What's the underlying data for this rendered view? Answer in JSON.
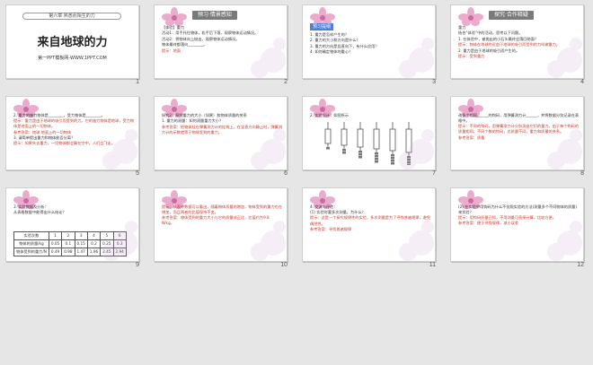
{
  "accent": "#4f7ed6",
  "slides": [
    {
      "num": "1",
      "chapter": "第六章 熟悉而陌生的力",
      "title": "来自地球的力",
      "footer": "第一PPT模板网-WWW.1PPT.COM"
    },
    {
      "num": "2",
      "band": "预习·情景感知",
      "lines": [
        "【体验】重力",
        "活动1：用手托住物体，松手后下落，观察物体运动情况。",
        "活动2：将物体向上抛出，观察物体运动情况。",
        "物体最终都落向________。"
      ],
      "hint": "提示：地面"
    },
    {
      "num": "3",
      "tag": "预习提纲",
      "lines": [
        "1. 重力是怎样产生的？",
        "2. 重力的大小和方向是什么？",
        "3. 重力的方向是竖直向下，有什么应用？",
        "4. 如何确定物体的重心？"
      ]
    },
    {
      "num": "4",
      "band": "探究·合作释疑",
      "lines": [
        "重力",
        "结合“体验”中的活动，思考以下问题。",
        "1. 在体验中，被抛出的小石头最终会落回地面？",
        "提示：物体在地球附近由于地球的吸引而受到的力叫做重力。",
        "2. 重力是由于地球的吸引而产生的。"
      ],
      "hint": "提示：受到重力"
    },
    {
      "num": "5",
      "lines": [
        "2. 重力的施力物体是________，受力物体是________。",
        "提示：重力是由于地球的吸引而受到的力。它的施力物体是地球，受力物体是地面上的一切物体。",
        "参考答案：地球 地面上的一切物体",
        "3. 请简单提出重力和物体能否分离？",
        "提示：如果失去重力，一切物体都会飘在空中，人们会飞走。"
      ]
    },
    {
      "num": "6",
      "lines": [
        "探究2：探究重力的大小（如果）和物体质量的关系",
        "1. 重力的测量：如何测量重力大小？",
        "参考答案：把物体挂在弹簧测力计的挂钩上，在竖直方向静止时，弹簧测力计的示数就等于物体受到的重力。"
      ]
    },
    {
      "num": "7",
      "lines": [
        "2. 实验设计：如图所示"
      ]
    },
    {
      "num": "8",
      "lines": [
        "改多个相同______的钩码，用弹簧测力计______，并将数据分别记录在表格中。",
        "提示：不同的钩码，用弹簧测力计分别测出它们的重力。由于每个钩码的质量相同，不同个数的钩码，总质量不同，重力和质量的关系。",
        "参考答案：质量"
      ]
    },
    {
      "num": "9",
      "lines": [
        "3. 实验数据及分析：",
        "从表格数据中能得出什么结论？"
      ],
      "table": {
        "headers": [
          "实验次数",
          "1",
          "2",
          "3",
          "4",
          "5",
          "6"
        ],
        "rows": [
          [
            "物体的质量/kg",
            "0.05",
            "0.1",
            "0.15",
            "0.2",
            "0.25",
            "0.3"
          ],
          [
            "物体受到的重力/N",
            "0.49",
            "0.98",
            "1.47",
            "1.96",
            "2.45",
            "2.94"
          ]
        ]
      }
    },
    {
      "num": "10",
      "lines": [
        "提示：从表中数据可以看出，随着物体质量的增加，物体受到的重力也在增加，而且两者的比值保持不变。",
        "参考答案：物体受到的重力大小与它的质量成正比，比值约为9.8 N/kg。"
      ]
    },
    {
      "num": "11",
      "lines": [
        "4. 交流与评估：",
        "(1) 实验时要多次测量，为什么？",
        "提示：这是一个探究规律性的实验，多次测量是为了寻找普遍规律，避免偶然性。",
        "参考答案：寻找普遍规律"
      ]
    },
    {
      "num": "12",
      "lines": [
        "(2) 在实验中用钩码为什么不仿照实验的方法(测量多个不同物体的质量)来实验？",
        "提示：用钩码质量已知，不用测量可直接计算，比较方便。",
        "参考答案：便于寻找规律，减小误差"
      ]
    }
  ]
}
